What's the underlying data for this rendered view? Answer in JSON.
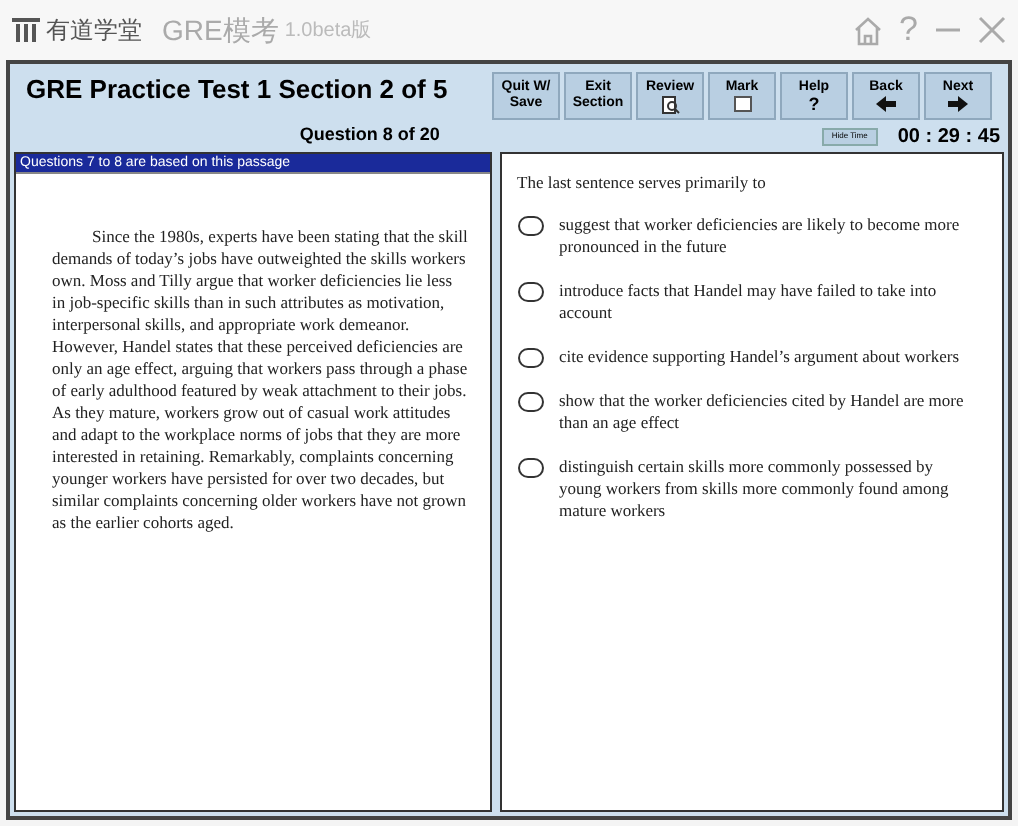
{
  "app_bar": {
    "brand": "有道学堂",
    "product": "GRE模考",
    "version": "1.0beta版",
    "controls": [
      "?"
    ]
  },
  "header": {
    "title": "GRE Practice Test 1 Section 2 of 5",
    "question_counter": "Question 8 of 20",
    "hide_time": "Hide Time",
    "timer": "00 : 29 : 45"
  },
  "toolbar": [
    {
      "kind": "text",
      "lines": [
        "Quit W/",
        "Save"
      ]
    },
    {
      "kind": "text",
      "lines": [
        "Exit",
        "Section"
      ]
    },
    {
      "kind": "review",
      "lines": [
        "Review"
      ]
    },
    {
      "kind": "mark",
      "lines": [
        "Mark"
      ]
    },
    {
      "kind": "glyph",
      "lines": [
        "Help",
        "?"
      ]
    },
    {
      "kind": "back",
      "lines": [
        "Back"
      ]
    },
    {
      "kind": "next",
      "lines": [
        "Next"
      ]
    }
  ],
  "passage": {
    "heading": "Questions 7 to 8 are based on this passage",
    "text": "Since the 1980s, experts have been stating that the skill demands of today’s jobs have outweighted the skills workers own. Moss and Tilly argue that worker deficiencies lie less in job-specific skills than in such attributes as motivation, interpersonal skills, and appropriate work demeanor. However, Handel states that these perceived deficiencies are only an age effect, arguing that workers pass through a phase of early adulthood featured by weak attachment to their jobs. As they mature, workers grow out of casual work attitudes and adapt to the workplace norms of jobs that they are more interested in retaining. Remarkably, complaints concerning younger workers have persisted for over two decades, but similar complaints concerning older workers have not grown as the earlier cohorts aged."
  },
  "question": {
    "prompt": "The last sentence serves primarily to",
    "options": [
      {
        "text": "suggest that worker deficiencies are likely to become more pronounced in the future",
        "selected": false
      },
      {
        "text": "introduce facts that Handel may have failed to take into account",
        "selected": false
      },
      {
        "text": "cite evidence supporting Handel’s argument about workers",
        "selected": false
      },
      {
        "text": "show that the worker deficiencies cited by Handel are more than an age effect",
        "selected": false
      },
      {
        "text": "distinguish certain skills more commonly possessed by young workers from skills more commonly found among mature workers",
        "selected": false
      }
    ]
  }
}
